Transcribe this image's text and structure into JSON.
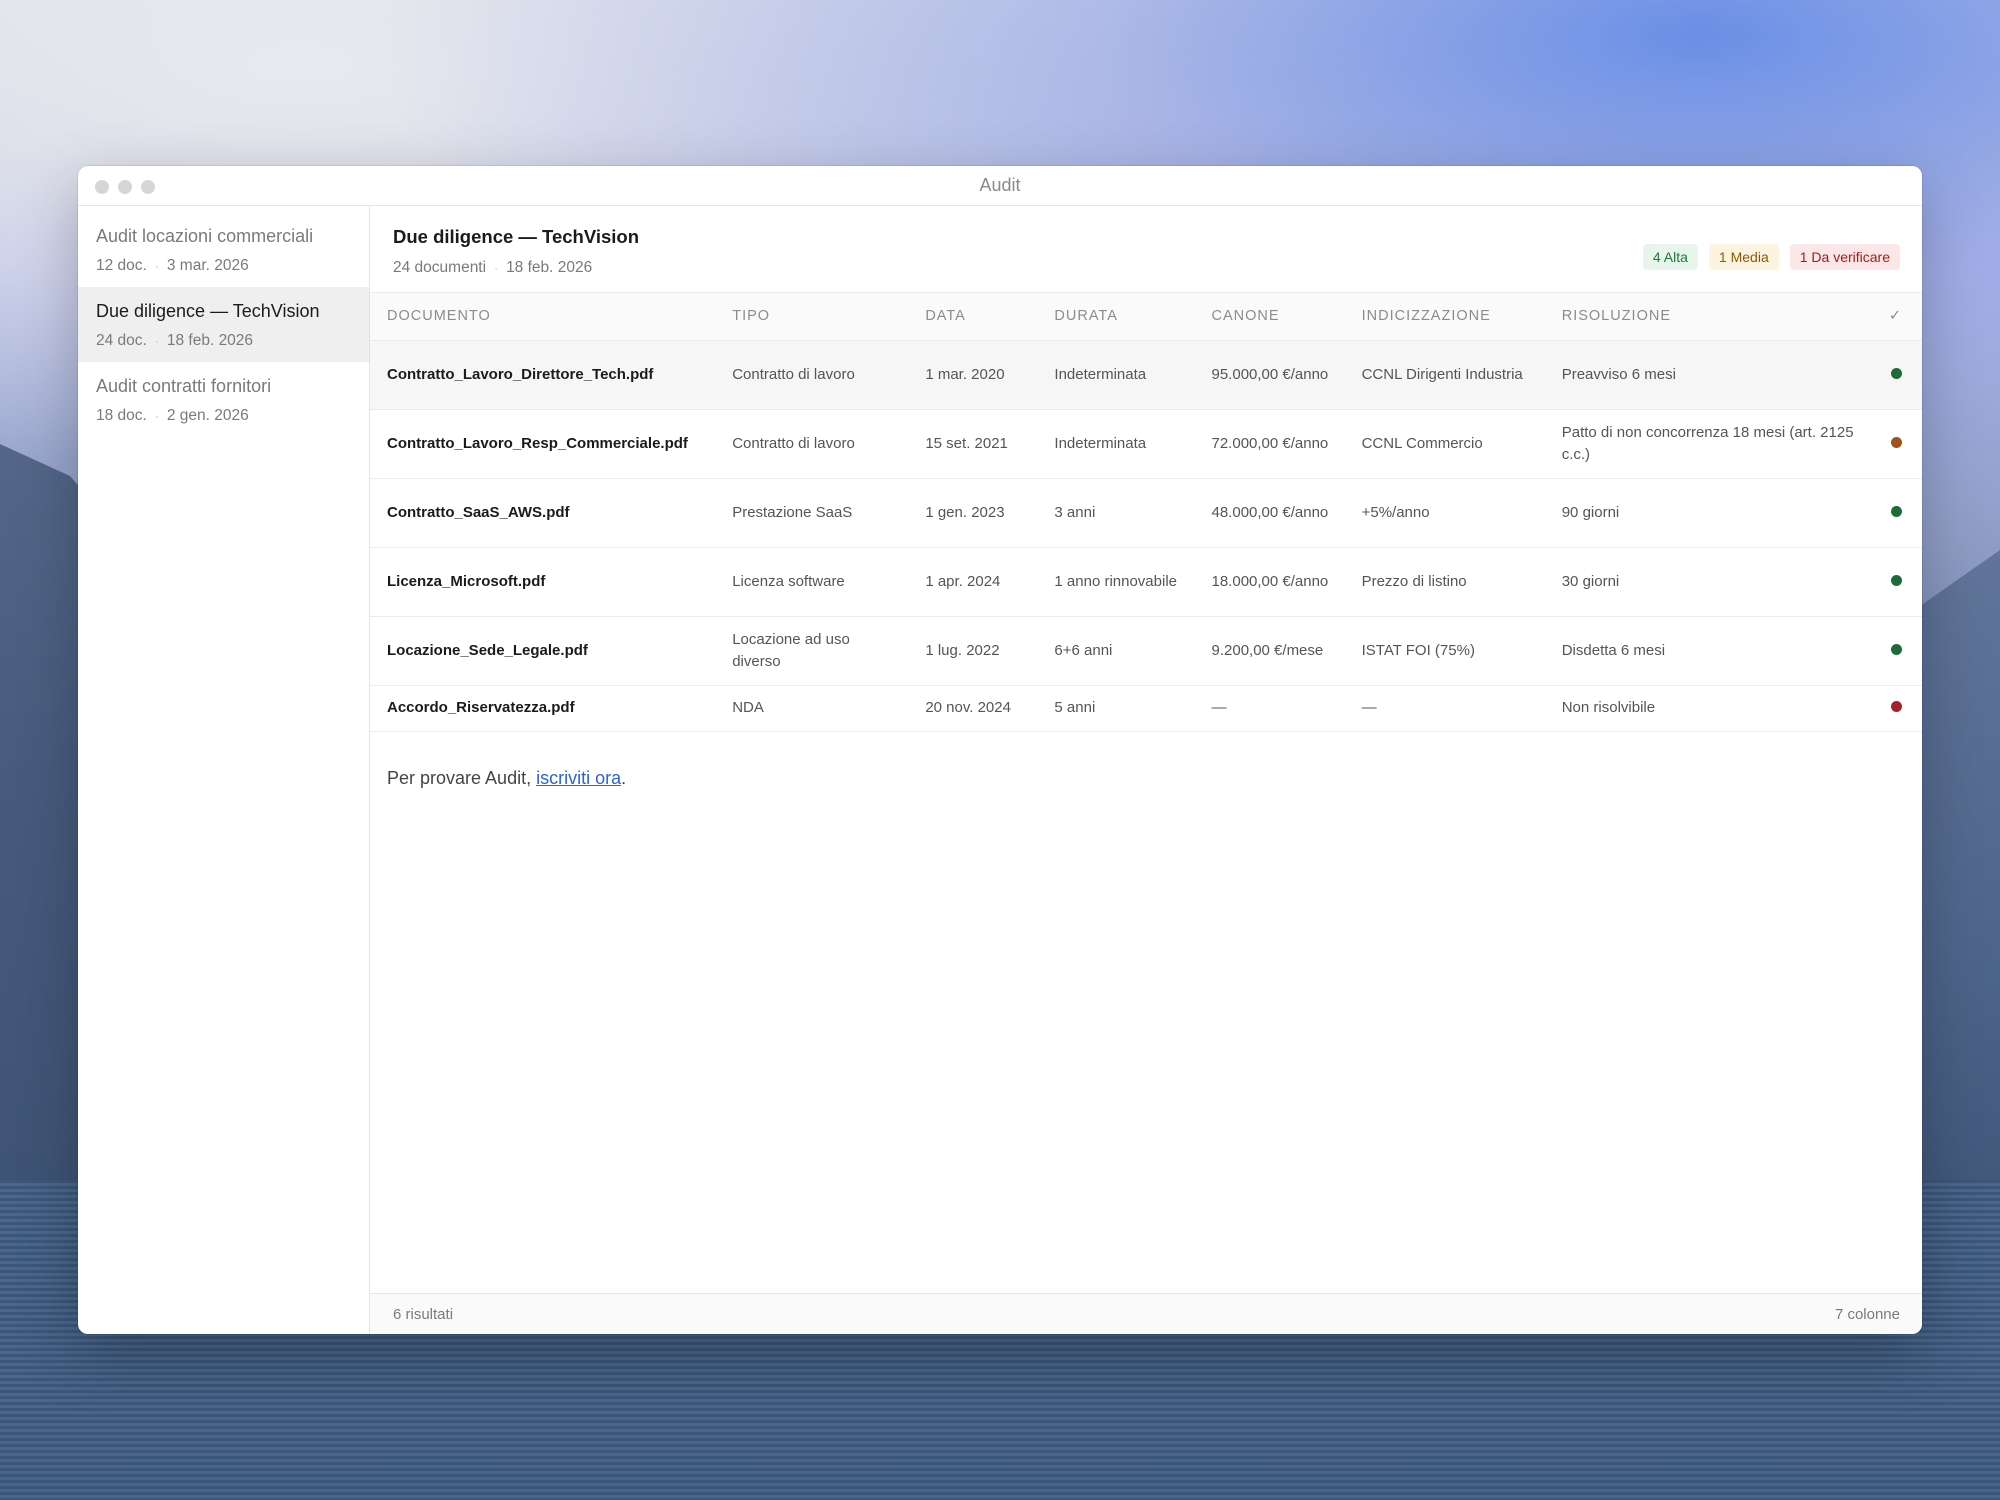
{
  "window": {
    "title": "Audit"
  },
  "sidebar": {
    "items": [
      {
        "title": "Audit locazioni commerciali",
        "docs": "12 doc.",
        "date": "3 mar. 2026",
        "active": false
      },
      {
        "title": "Due diligence — TechVision",
        "docs": "24 doc.",
        "date": "18 feb. 2026",
        "active": true
      },
      {
        "title": "Audit contratti fornitori",
        "docs": "18 doc.",
        "date": "2 gen. 2026",
        "active": false
      }
    ]
  },
  "main": {
    "title": "Due diligence — TechVision",
    "docs": "24 documenti",
    "date": "18 feb. 2026",
    "badges": [
      {
        "label": "4 Alta",
        "color": "#1f7a3a",
        "bg": "#e8f5ec"
      },
      {
        "label": "1 Media",
        "color": "#8a5a00",
        "bg": "#fdf3e1"
      },
      {
        "label": "1 Da verificare",
        "color": "#a01c1c",
        "bg": "#fbe7e7"
      }
    ]
  },
  "table": {
    "headers": [
      "DOCUMENTO",
      "TIPO",
      "DATA",
      "DURATA",
      "CANONE",
      "INDICIZZAZIONE",
      "RISOLUZIONE",
      "✓"
    ],
    "rows": [
      {
        "doc": "Contratto_Lavoro_Direttore_Tech.pdf",
        "tipo": "Contratto di lavoro",
        "data": "1 mar. 2020",
        "durata": "Indeterminata",
        "canone": "95.000,00 €/anno",
        "indicizzazione": "CCNL Dirigenti Industria",
        "risoluzione": "Preavviso 6 mesi",
        "status": "#1e6b3a"
      },
      {
        "doc": "Contratto_Lavoro_Resp_Commerciale.pdf",
        "tipo": "Contratto di lavoro",
        "data": "15 set. 2021",
        "durata": "Indeterminata",
        "canone": "72.000,00 €/anno",
        "indicizzazione": "CCNL Commercio",
        "risoluzione": "Patto di non concorrenza 18 mesi (art. 2125 c.c.)",
        "status": "#a0521c"
      },
      {
        "doc": "Contratto_SaaS_AWS.pdf",
        "tipo": "Prestazione SaaS",
        "data": "1 gen. 2023",
        "durata": "3 anni",
        "canone": "48.000,00 €/anno",
        "indicizzazione": "+5%/anno",
        "risoluzione": "90 giorni",
        "status": "#1e6b3a"
      },
      {
        "doc": "Licenza_Microsoft.pdf",
        "tipo": "Licenza software",
        "data": "1 apr. 2024",
        "durata": "1 anno rinnovabile",
        "canone": "18.000,00 €/anno",
        "indicizzazione": "Prezzo di listino",
        "risoluzione": "30 giorni",
        "status": "#1e6b3a"
      },
      {
        "doc": "Locazione_Sede_Legale.pdf",
        "tipo": "Locazione ad uso diverso",
        "data": "1 lug. 2022",
        "durata": "6+6 anni",
        "canone": "9.200,00 €/mese",
        "indicizzazione": "ISTAT FOI (75%)",
        "risoluzione": "Disdetta 6 mesi",
        "status": "#1e6b3a"
      },
      {
        "doc": "Accordo_Riservatezza.pdf",
        "tipo": "NDA",
        "data": "20 nov. 2024",
        "durata": "5 anni",
        "canone": "—",
        "indicizzazione": "—",
        "risoluzione": "Non risolvibile",
        "status": "#a8202a"
      }
    ]
  },
  "cta": {
    "prefix": "Per provare Audit, ",
    "link": "iscriviti ora",
    "suffix": "."
  },
  "footer": {
    "results": "6 risultati",
    "columns": "7 colonne"
  }
}
